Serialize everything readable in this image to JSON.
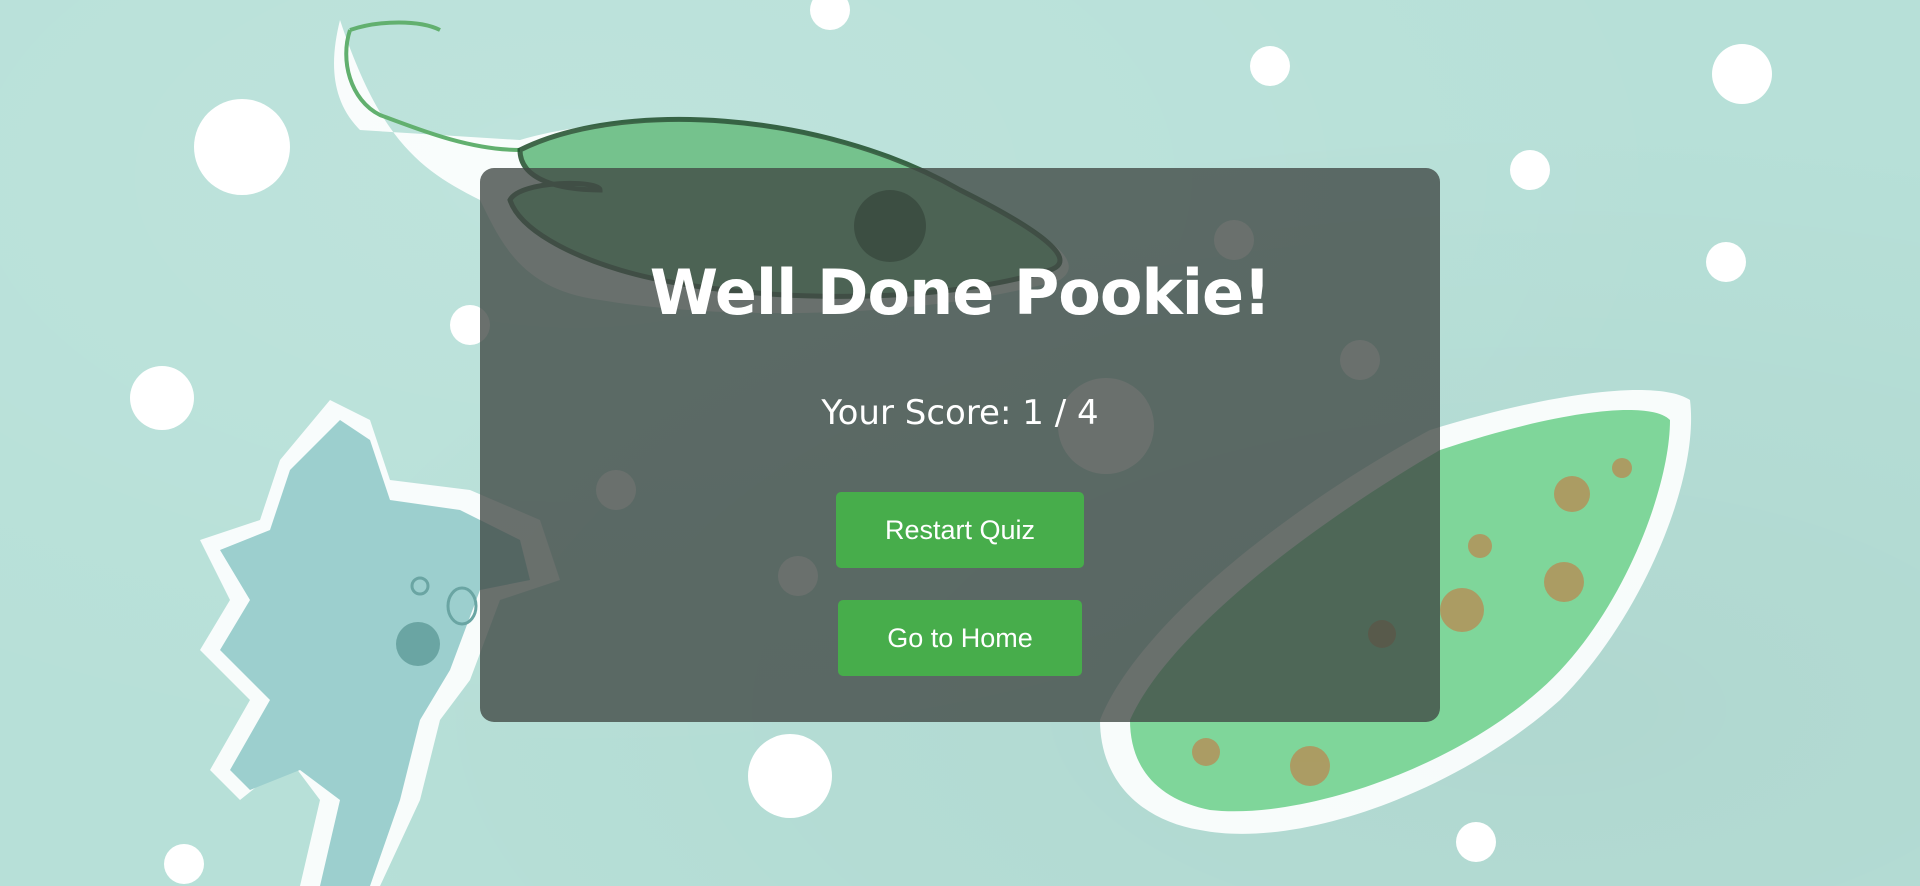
{
  "quiz_result": {
    "title": "Well Done Pookie!",
    "score_label": "Your Score:",
    "score_value": "1",
    "score_separator": "/",
    "score_total": "4",
    "restart_label": "Restart Quiz",
    "home_label": "Go to Home"
  },
  "colors": {
    "background": "#b7e0d8",
    "panel": "rgba(64,72,68,0.78)",
    "button": "#47ad4b",
    "text": "#ffffff"
  },
  "background_art": {
    "illustration": "microorganisms-paper-cutout",
    "icons": [
      "paramecium-icon",
      "amoeba-icon",
      "green-bacterium-icon",
      "bubble-icon"
    ]
  }
}
